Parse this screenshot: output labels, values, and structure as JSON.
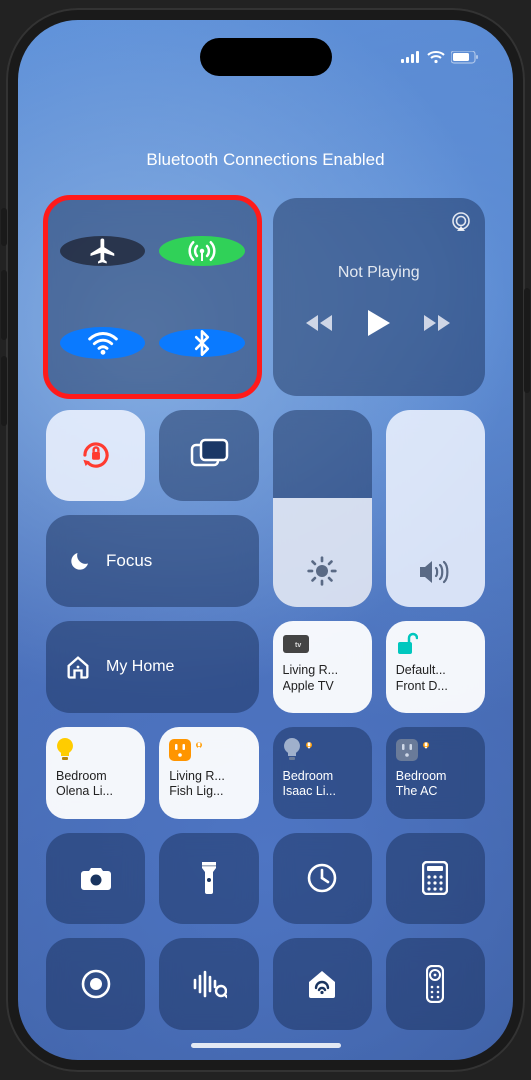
{
  "title": "Bluetooth Connections Enabled",
  "connectivity": {
    "airplane": {
      "state": "off",
      "icon": "airplane-icon"
    },
    "cellular": {
      "state": "on",
      "icon": "cellular-antenna-icon",
      "color": "#30d158"
    },
    "wifi": {
      "state": "on",
      "icon": "wifi-icon",
      "color": "#0a7aff"
    },
    "bluetooth": {
      "state": "on",
      "icon": "bluetooth-icon",
      "color": "#0a7aff"
    }
  },
  "media": {
    "now_playing_label": "Not Playing",
    "airplay_icon": "airplay-icon"
  },
  "orientation_lock": {
    "state": "on",
    "icon": "orientation-lock-icon",
    "color": "#ff3b30"
  },
  "screen_mirroring": {
    "icon": "screen-mirroring-icon"
  },
  "focus": {
    "label": "Focus",
    "icon": "moon-icon"
  },
  "brightness": {
    "value_pct": 55,
    "icon": "sun-icon"
  },
  "volume": {
    "value_pct": 100,
    "icon": "speaker-icon"
  },
  "my_home": {
    "label": "My Home",
    "icon": "house-icon"
  },
  "accessories": {
    "apple_tv": {
      "line1": "Living R...",
      "line2": "Apple TV",
      "kind": "appletv",
      "bg": "light"
    },
    "front_door": {
      "line1": "Default...",
      "line2": "Front D...",
      "kind": "lock-open",
      "bg": "light",
      "color": "#00c7be"
    },
    "bedroom_olena": {
      "line1": "Bedroom",
      "line2": "Olena Li...",
      "kind": "bulb",
      "bg": "light",
      "color": "#ffcc00"
    },
    "living_fish": {
      "line1": "Living R...",
      "line2": "Fish Lig...",
      "kind": "outlet",
      "bg": "light",
      "color": "#ff9500",
      "warn": true
    },
    "bedroom_isaac": {
      "line1": "Bedroom",
      "line2": "Isaac Li...",
      "kind": "bulb",
      "bg": "dark",
      "warn": true
    },
    "bedroom_ac": {
      "line1": "Bedroom",
      "line2": "The AC",
      "kind": "outlet",
      "bg": "dark",
      "warn": true
    }
  },
  "utilities": {
    "camera": "camera-icon",
    "flashlight": "flashlight-icon",
    "timer": "timer-icon",
    "calculator": "calculator-icon",
    "screen_record": "screen-record-icon",
    "shazam": "shazam-icon",
    "home": "home-icon",
    "apple_tv_remote": "apple-tv-remote-icon"
  },
  "highlight": "connectivity-panel"
}
